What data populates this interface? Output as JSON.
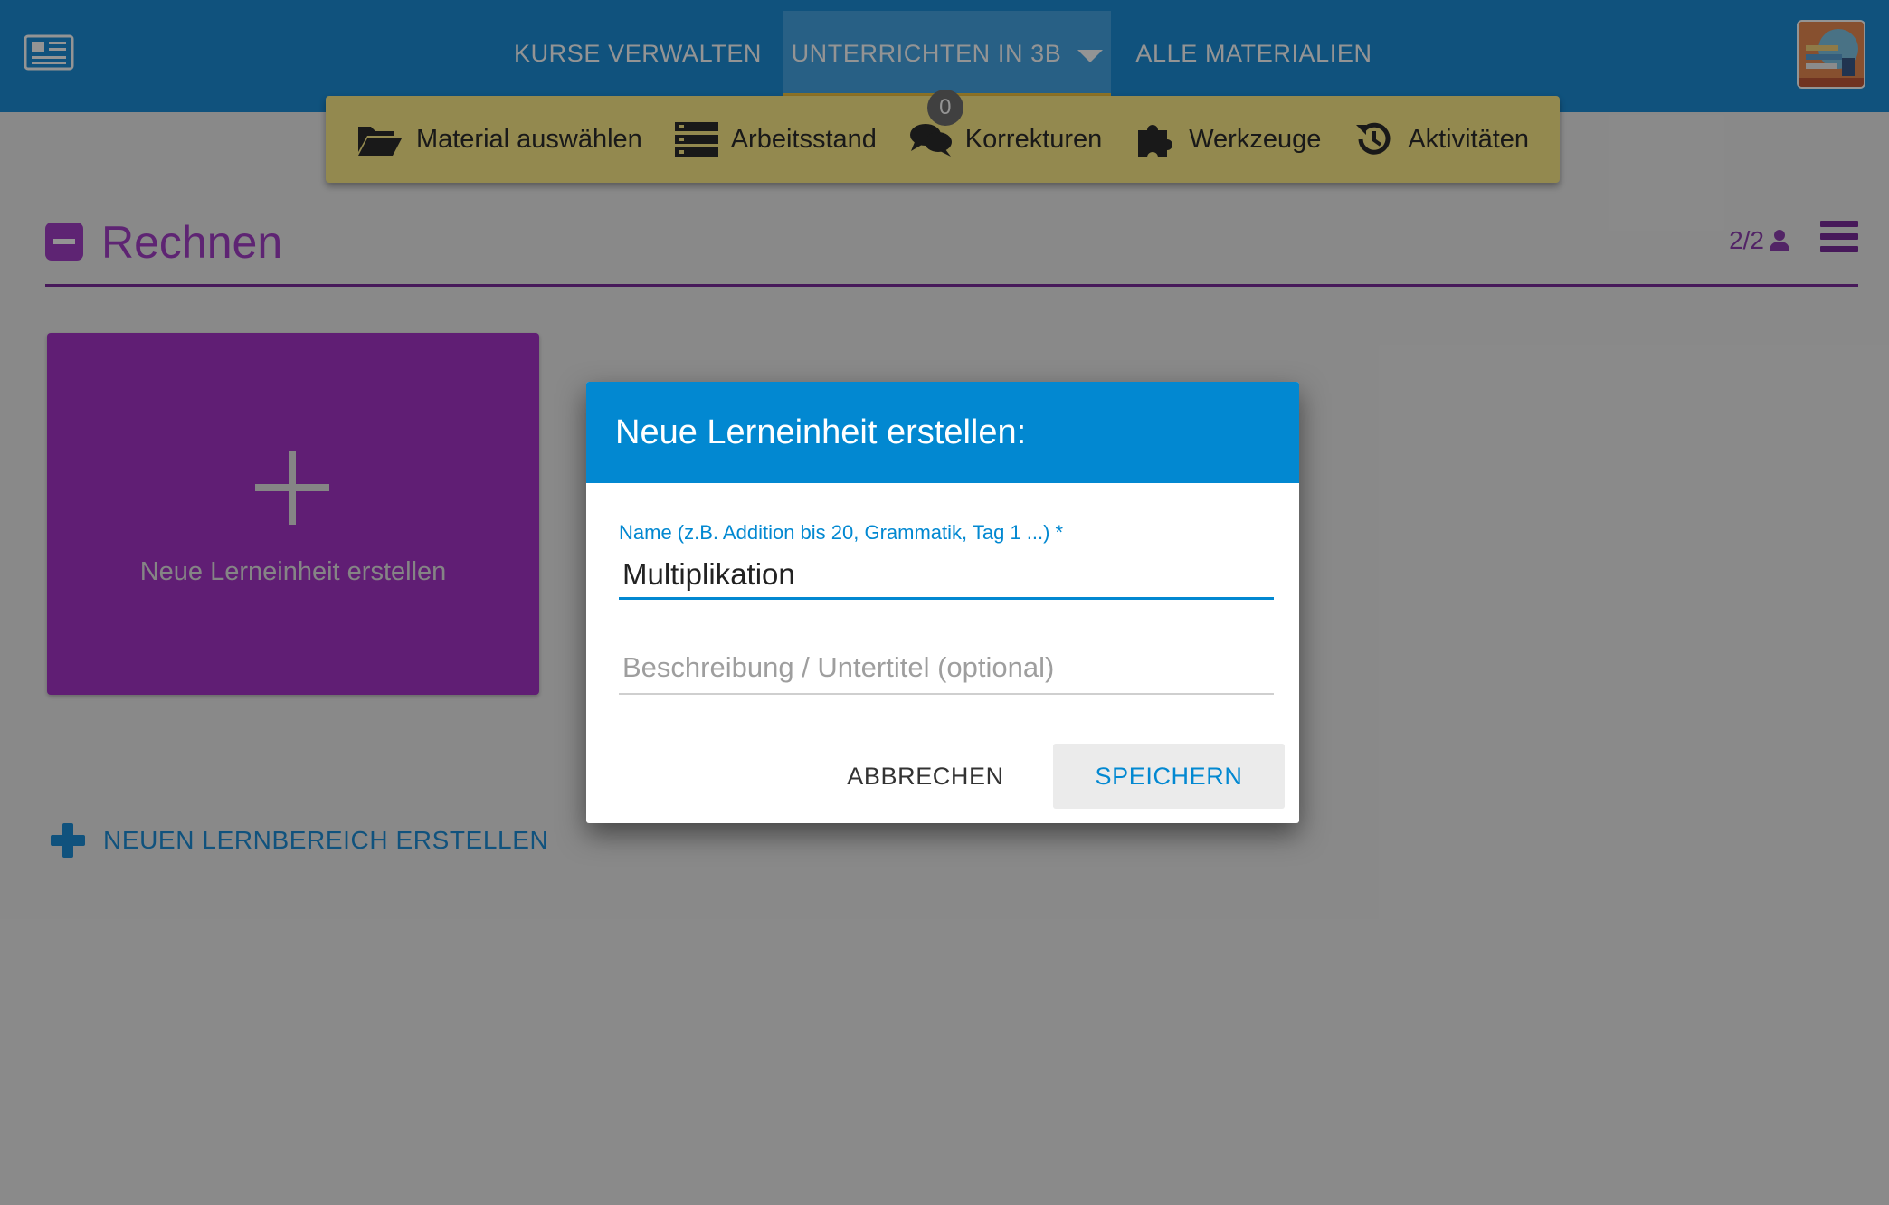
{
  "appbar": {
    "nav": [
      {
        "label": "KURSE VERWALTEN"
      },
      {
        "label": "UNTERRICHTEN IN 3B"
      },
      {
        "label": "ALLE MATERIALIEN"
      }
    ]
  },
  "toolbar": {
    "material": "Material auswählen",
    "progress": "Arbeitsstand",
    "corrections": "Korrekturen",
    "corrections_count": "0",
    "tools": "Werkzeuge",
    "activities": "Aktivitäten"
  },
  "section": {
    "title": "Rechnen",
    "members": "2/2"
  },
  "tile": {
    "label": "Neue Lerneinheit erstellen"
  },
  "new_area": {
    "label": "NEUEN LERNBEREICH ERSTELLEN"
  },
  "dialog": {
    "title": "Neue Lerneinheit erstellen:",
    "name_label": "Name (z.B. Addition bis 20, Grammatik, Tag 1 ...) *",
    "name_value": "Multiplikation",
    "desc_placeholder": "Beschreibung / Untertitel (optional)",
    "cancel": "ABBRECHEN",
    "save": "SPEICHERN"
  },
  "colors": {
    "appbar": "#1c8ed8",
    "toolbar": "#fdec88",
    "accent_purple": "#a33fc6",
    "dialog_header": "#0288d1"
  }
}
